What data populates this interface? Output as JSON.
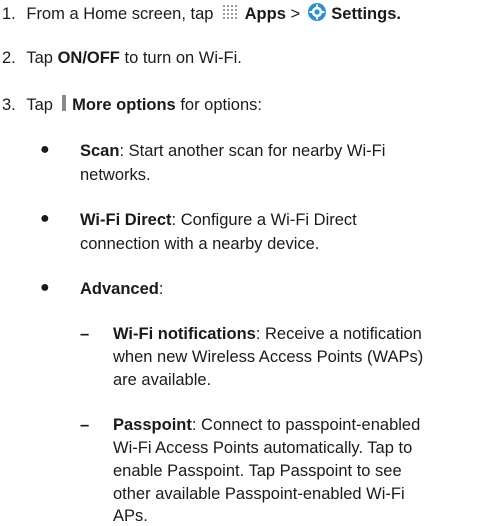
{
  "steps": [
    {
      "num": "1.",
      "pre": "From a Home screen, tap",
      "apps_icon": "apps-grid-icon",
      "apps": "Apps",
      "sep": ">",
      "settings_icon": "settings-gear-icon",
      "settings": "Settings",
      "end": "."
    },
    {
      "num": "2.",
      "pre": "Tap",
      "bold": "ON/OFF",
      "post": "to turn on Wi-Fi."
    },
    {
      "num": "3.",
      "pre": "Tap",
      "more_icon": "more-options-icon",
      "bold": "More options",
      "post": "for options:"
    }
  ],
  "options": {
    "scan": {
      "term": "Scan",
      "line1": ": Start another scan for nearby Wi-Fi",
      "line2": "networks."
    },
    "wifi_direct": {
      "term": "Wi-Fi Direct",
      "line1": ": Configure a Wi-Fi Direct",
      "line2": "connection with a nearby device."
    },
    "advanced": {
      "term": "Advanced",
      "line1": ":"
    }
  },
  "advanced_items": {
    "notifications": {
      "term": "Wi-Fi notifications",
      "line1": ": Receive a notification",
      "line2": "when new Wireless Access Points (WAPs)",
      "line3": "are available."
    },
    "passpoint": {
      "term": "Passpoint",
      "line1": ": Connect to passpoint-enabled",
      "line2": "Wi-Fi Access Points automatically. Tap to",
      "line3": "enable Passpoint. Tap Passpoint to see",
      "line4": "other available Passpoint-enabled Wi-Fi",
      "line5": "APs."
    }
  },
  "colors": {
    "text": "#1a1a1a",
    "settings_icon": "#2a8fd6"
  }
}
